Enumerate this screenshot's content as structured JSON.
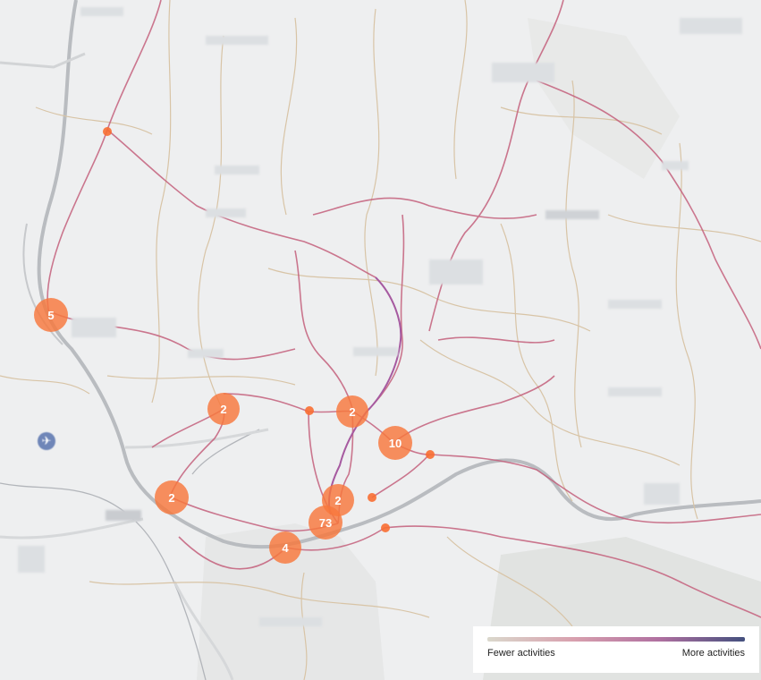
{
  "map": {
    "clusters": [
      {
        "count": "5",
        "size": 38
      },
      {
        "count": "2",
        "size": 36
      },
      {
        "count": "2",
        "size": 36
      },
      {
        "count": "10",
        "size": 38
      },
      {
        "count": "2",
        "size": 38
      },
      {
        "count": "2",
        "size": 36
      },
      {
        "count": "73",
        "size": 38
      },
      {
        "count": "4",
        "size": 36
      }
    ],
    "activity_dot_count": 5
  },
  "legend": {
    "low_label": "Fewer activities",
    "high_label": "More activities",
    "gradient_colors": [
      "#dad8cc",
      "#d8a0ae",
      "#b070a0",
      "#44507e"
    ]
  },
  "colors": {
    "background": "#eeeff0",
    "cluster": "#f8783c",
    "route_low": "#d8c4a6",
    "route_high": "#c4607c"
  }
}
